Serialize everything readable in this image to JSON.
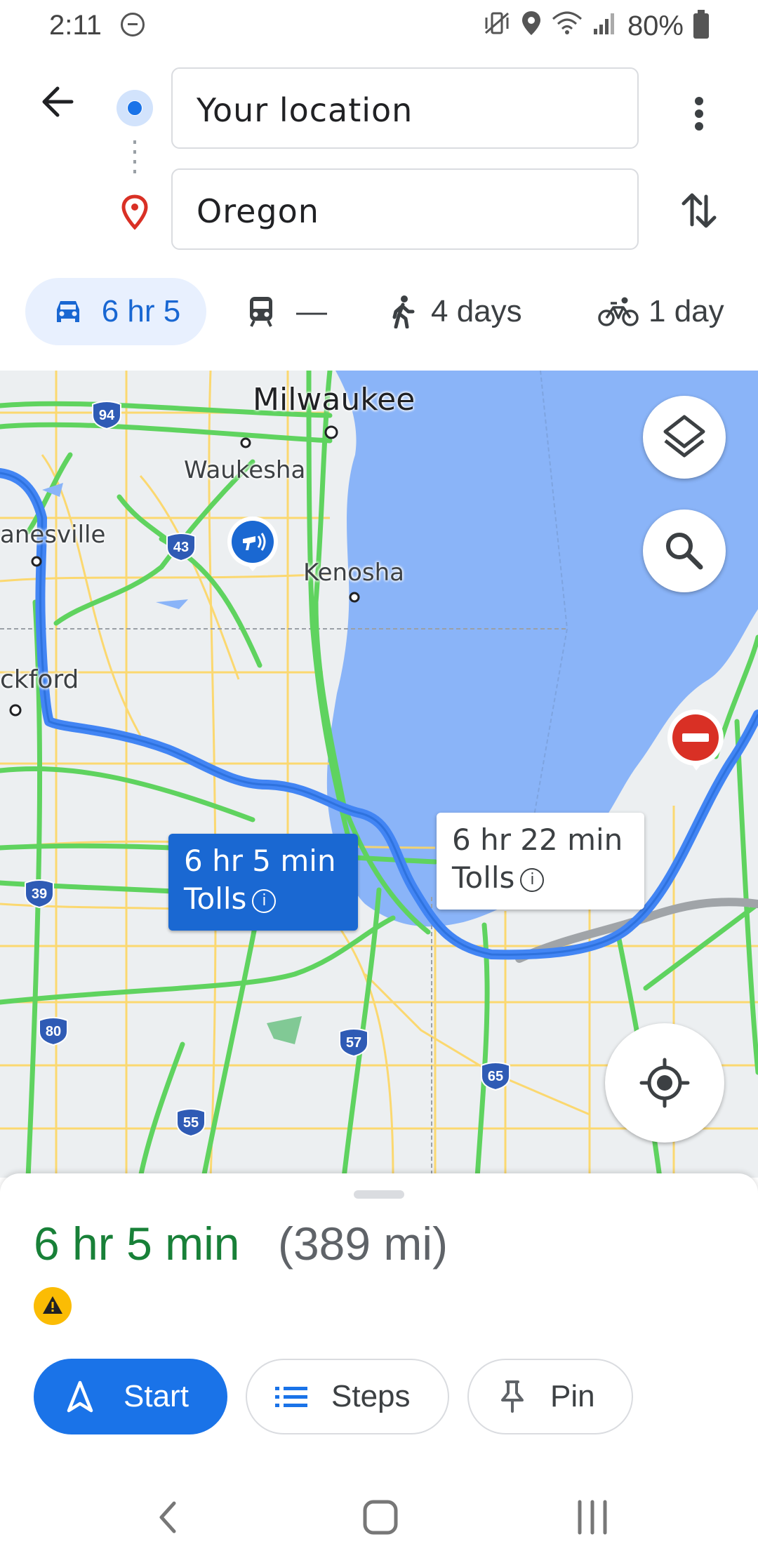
{
  "status_bar": {
    "time": "2:11",
    "battery": "80%",
    "icons": [
      "dnd-icon",
      "vibrate-icon",
      "location-icon",
      "wifi-icon",
      "signal-icon",
      "battery-icon"
    ]
  },
  "directions": {
    "origin": "Your location",
    "destination": "Oregon"
  },
  "modes": [
    {
      "icon": "car-icon",
      "label": "6 hr 5",
      "selected": true
    },
    {
      "icon": "train-icon",
      "label": "—",
      "selected": false
    },
    {
      "icon": "walk-icon",
      "label": "4 days",
      "selected": false
    },
    {
      "icon": "bike-icon",
      "label": "1 day",
      "selected": false
    }
  ],
  "map": {
    "cities": {
      "milwaukee": "Milwaukee",
      "waukesha": "Waukesha",
      "janesville": "anesville",
      "kenosha": "Kenosha",
      "rockford": "ckford"
    },
    "shields": {
      "i94": "94",
      "i43": "43",
      "i39": "39",
      "i80": "80",
      "i57": "57",
      "i55": "55",
      "i65": "65"
    },
    "route_primary": {
      "time": "6 hr 5 min",
      "tolls": "Tolls"
    },
    "route_alt": {
      "time": "6 hr 22 min",
      "tolls": "Tolls"
    },
    "colors": {
      "water": "#8ab4f8",
      "route": "#4285f4",
      "traffic": "#5fd35f",
      "road": "#fdd663",
      "alt_route": "#a0a4a8"
    }
  },
  "summary": {
    "duration": "6 hr 5 min",
    "distance": "(389 mi)"
  },
  "actions": {
    "start": "Start",
    "steps": "Steps",
    "pin": "Pin"
  }
}
